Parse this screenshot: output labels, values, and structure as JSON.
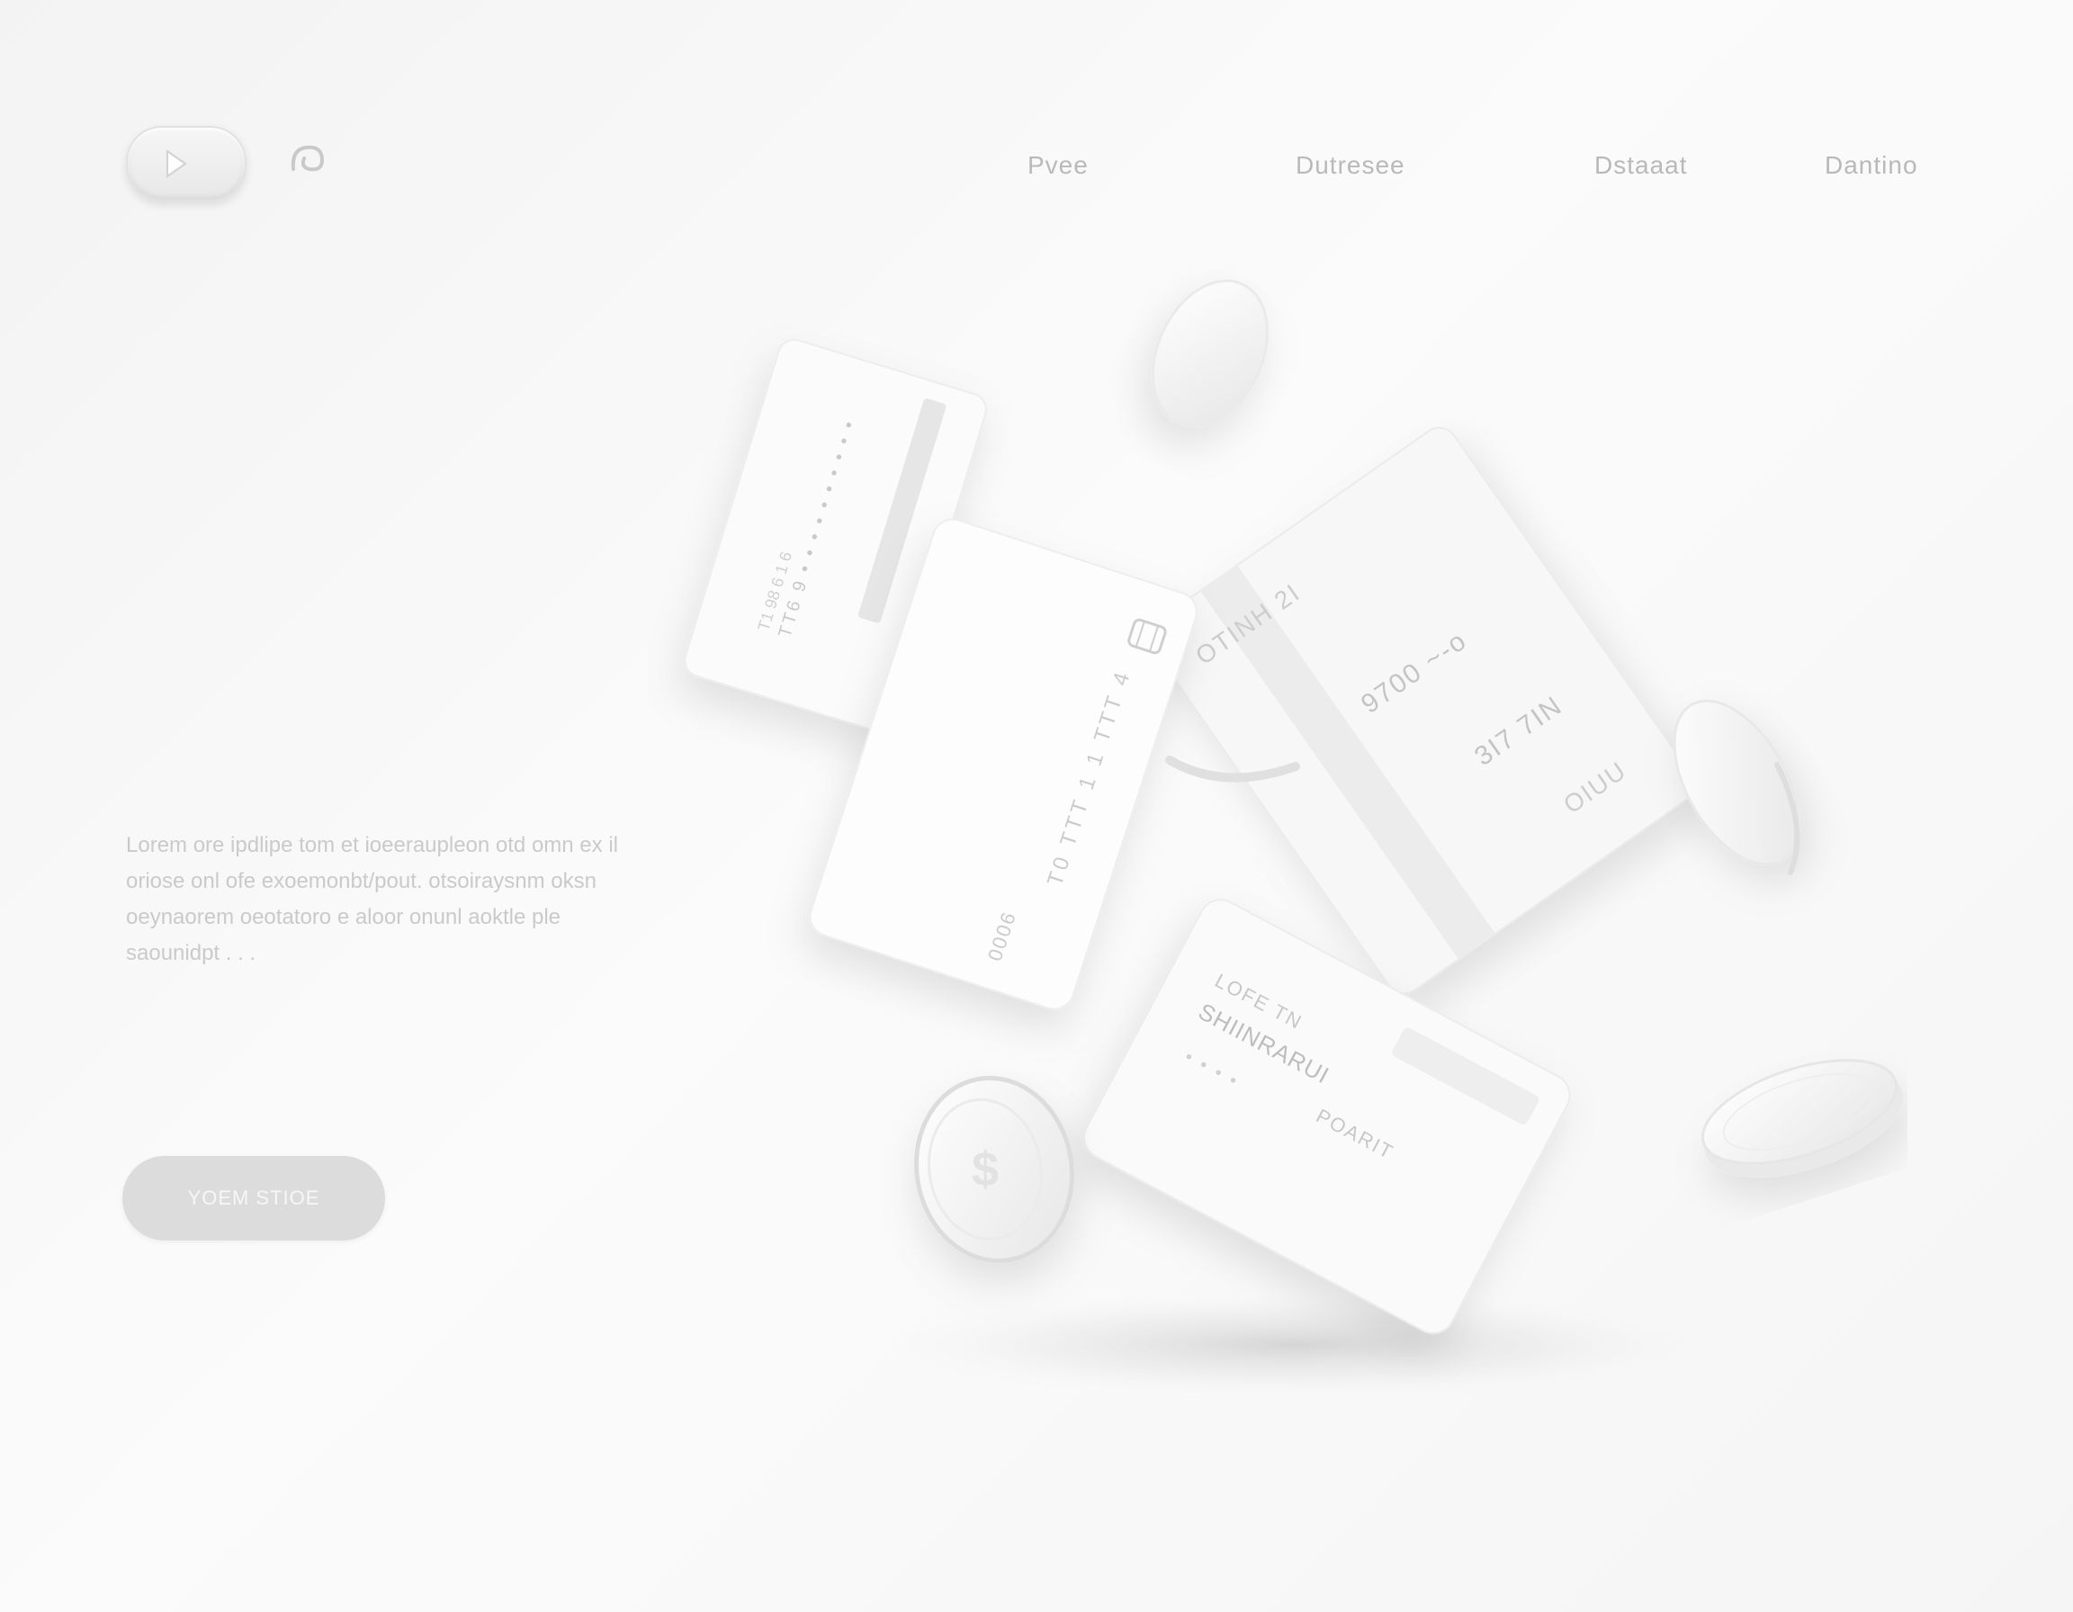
{
  "nav": {
    "items": [
      "Pvee",
      "Dutresee",
      "Dstaaat",
      "Dantino"
    ]
  },
  "hero": {
    "description": "Lorem ore ipdlipe tom et ioeeraupleon otd omn ex il oriose onl ofe exoemonbt/pout. otsoiraysnm oksn oeynaorem oeotatoro e aloor onunl aoktle ple saounidpt . . .",
    "cta_label": "YOEM STIOE"
  },
  "cards": {
    "card1_text": [
      "TT6 9 • • • • • • • • • •",
      "T1 98 6 1 6"
    ],
    "card2_text": [
      "T0 TTT 1 1 TTT 4",
      "0006"
    ],
    "card3_text": [
      "OTINH 2I",
      "9700 ~-o",
      "3I7 7IN",
      "OIUU"
    ],
    "card4_text": [
      "LOFE TN",
      "SHIINRARUI",
      "POARIT",
      "• • • •"
    ],
    "coin_symbol": "$"
  },
  "colors": {
    "background": "#f6f6f6",
    "card": "#fbfbfb",
    "nav_text": "#b9b9b9",
    "body_text": "#cacaca",
    "button": "#dcdcdc"
  }
}
